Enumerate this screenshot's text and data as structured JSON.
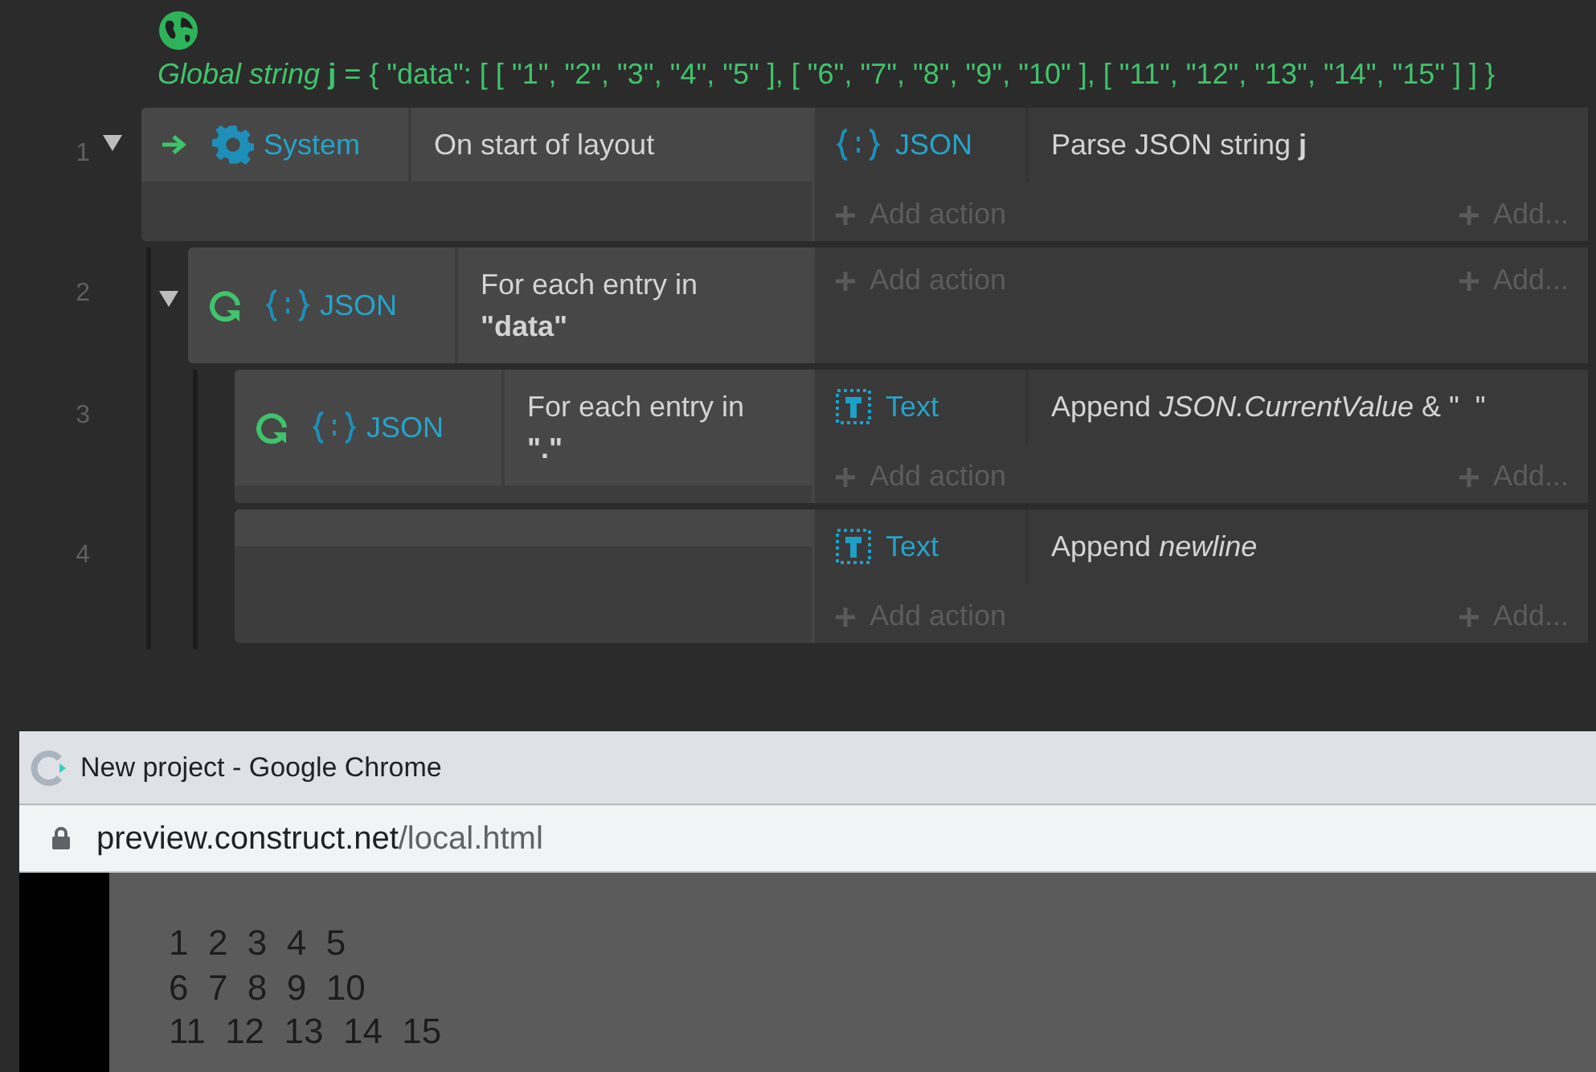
{
  "global_variable": {
    "text": "*Global string* **j** = { \"data\": [ [ \"1\", \"2\", \"3\", \"4\", \"5\" ], [ \"6\", \"7\", \"8\", \"9\", \"10\" ], [ \"11\", \"12\", \"13\", \"14\", \"15\" ] ] }"
  },
  "events": [
    {
      "number": "1",
      "expanded": true,
      "conditions": [
        {
          "kind": "trigger",
          "object": {
            "kind": "system",
            "name": "System"
          },
          "text": "On start of layout"
        }
      ],
      "actions": [
        {
          "object": {
            "kind": "json",
            "name": "JSON"
          },
          "text": "Parse JSON string **j**"
        }
      ],
      "add_action": "Add action",
      "add_more": "Add...",
      "children": [
        {
          "number": "2",
          "expanded": true,
          "conditions": [
            {
              "kind": "loop",
              "object": {
                "kind": "json",
                "name": "JSON"
              },
              "text": "For each entry in **\"data\"**"
            }
          ],
          "add_action": "Add action",
          "add_more": "Add...",
          "children": [
            {
              "number": "3",
              "conditions": [
                {
                  "kind": "loop",
                  "object": {
                    "kind": "json",
                    "name": "JSON"
                  },
                  "text": "For each entry in **\".\"**"
                }
              ],
              "actions": [
                {
                  "object": {
                    "kind": "text",
                    "name": "Text"
                  },
                  "text": "Append *JSON.CurrentValue* & \"  \""
                }
              ],
              "add_action": "Add action",
              "add_more": "Add..."
            },
            {
              "number": "4",
              "actions": [
                {
                  "object": {
                    "kind": "text",
                    "name": "Text"
                  },
                  "text": "Append *newline*"
                }
              ],
              "add_action": "Add action",
              "add_more": "Add..."
            }
          ]
        }
      ]
    }
  ],
  "browser": {
    "title": "New project - Google Chrome",
    "url_host": "preview.construct.net",
    "url_path": "/local.html",
    "output_lines": [
      "1  2  3  4  5",
      "6  7  8  9  10",
      "11  12  13  14  15"
    ]
  }
}
